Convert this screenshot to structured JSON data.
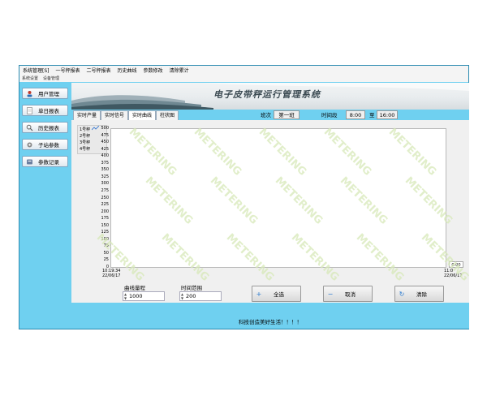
{
  "menu": [
    "系统管理[S]",
    "一号秤报表",
    "二号秤报表",
    "历史曲线",
    "参数修改",
    "清除累计"
  ],
  "submenu": [
    "系统设置",
    "设备管理"
  ],
  "sidebar": {
    "items": [
      {
        "label": "用户管理",
        "icon": "user-icon"
      },
      {
        "label": "单日报表",
        "icon": "document-icon"
      },
      {
        "label": "历史报表",
        "icon": "search-icon"
      },
      {
        "label": "子站参数",
        "icon": "gear-icon"
      },
      {
        "label": "参数记录",
        "icon": "record-icon"
      }
    ]
  },
  "banner": {
    "title": "电子皮带秤运行管理系统"
  },
  "tabs": [
    "实时产量",
    "实时信号",
    "实时曲线",
    "柱状图"
  ],
  "shift": {
    "label": "班次",
    "value": "第一班"
  },
  "timeslot": {
    "label": "时间段",
    "start": "8:00",
    "sep": "至",
    "end": "16:00"
  },
  "chart_data": {
    "type": "line",
    "title": "",
    "xlabel": "",
    "ylabel": "",
    "ylim": [
      0,
      500
    ],
    "yticks": [
      "500",
      "475",
      "450",
      "425",
      "400",
      "375",
      "350",
      "325",
      "300",
      "275",
      "250",
      "225",
      "200",
      "175",
      "150",
      "125",
      "100",
      "75",
      "50",
      "25",
      "0"
    ],
    "x_start": "10:19:34\n22/06/17",
    "x_end": "11:0\n22/06/17",
    "series": [
      {
        "name": "1号秤",
        "values": []
      },
      {
        "name": "2号秤",
        "values": []
      },
      {
        "name": "3号秤",
        "values": []
      },
      {
        "name": "4号秤",
        "values": []
      }
    ],
    "value_box": "0.00",
    "grid": false
  },
  "controls": {
    "range_label": "曲线量程",
    "range_value": "1000",
    "time_label": "时间范围",
    "time_value": "200",
    "btn_all": "全选",
    "btn_cancel": "取消",
    "btn_clear": "清除"
  },
  "status": "科技创造美好生活！！！！",
  "watermark": "METERING"
}
